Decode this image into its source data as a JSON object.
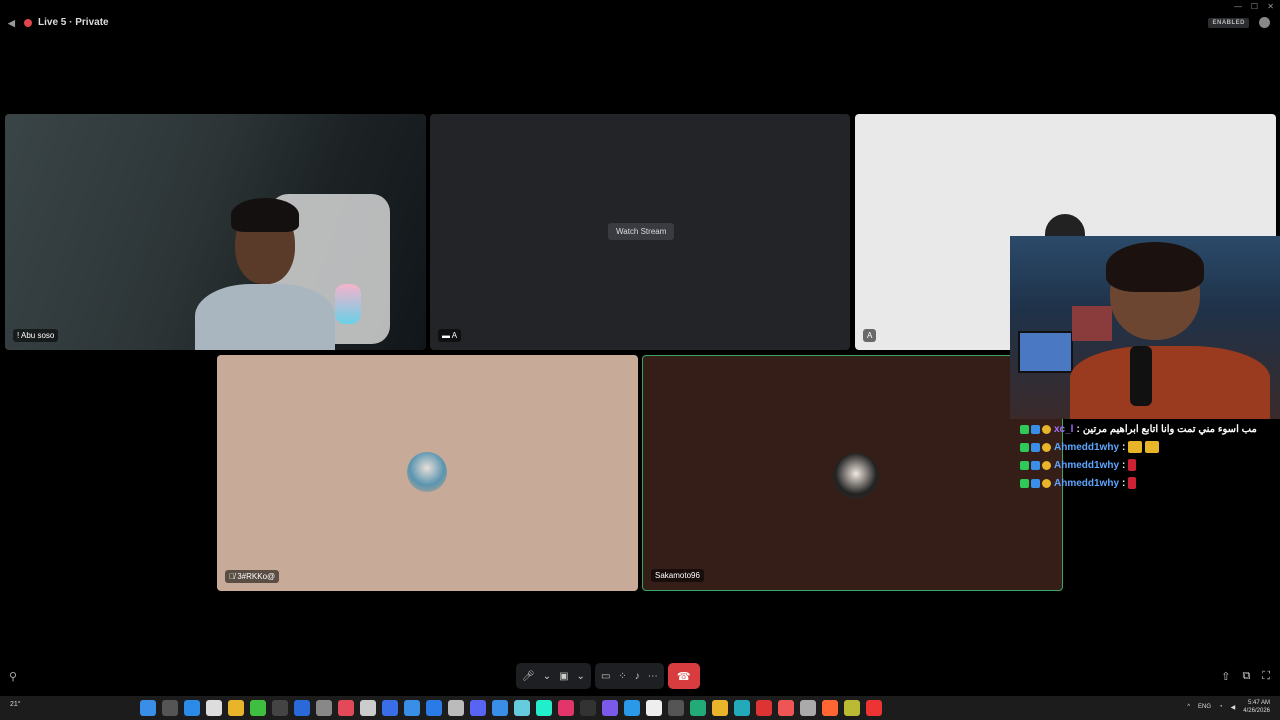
{
  "titlebar": {
    "channel": "Live 5 · Private",
    "enabled_badge": "ENABLED",
    "window_controls": [
      "—",
      "☐",
      "✕"
    ]
  },
  "tiles": [
    {
      "label": "Abu soso"
    },
    {
      "label": "A",
      "watch_button": "Watch Stream"
    },
    {
      "label": "A"
    },
    {
      "label": "3#RKKo@"
    },
    {
      "label": "Sakamoto96"
    }
  ],
  "chat": [
    {
      "user": "xc_l",
      "message": "مب اسوء مني تمت وانا اتابع ابراهيم مرتين"
    },
    {
      "user": "Ahmedd1why",
      "message": ""
    },
    {
      "user": "Ahmedd1why",
      "message": ""
    },
    {
      "user": "Ahmedd1why",
      "message": ""
    }
  ],
  "taskbar": {
    "weather": "21°",
    "lang": "ENG",
    "time": "5:47 AM",
    "date": "4/26/2026"
  },
  "colors": {
    "hangup": "#d83c3e",
    "speaking_border": "#3ba55d",
    "chat_user": "#5ea6ff"
  }
}
